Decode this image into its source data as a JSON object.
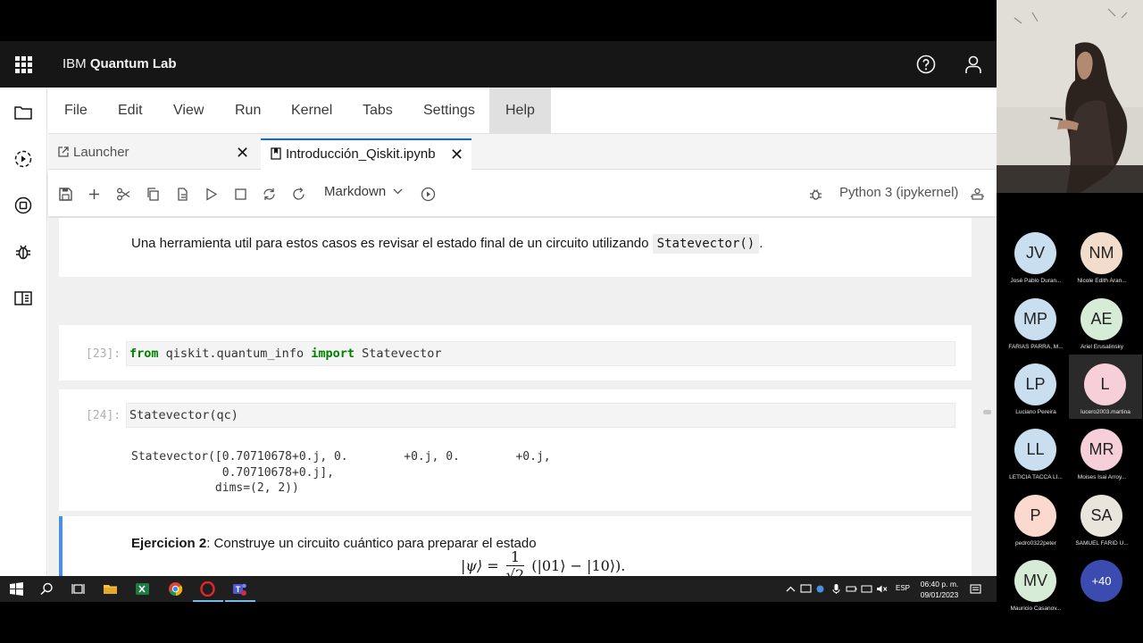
{
  "app": {
    "brand_prefix": "IBM ",
    "brand_name": "Quantum Lab"
  },
  "menu": [
    "File",
    "Edit",
    "View",
    "Run",
    "Kernel",
    "Tabs",
    "Settings",
    "Help"
  ],
  "tabs": {
    "launcher": "Launcher",
    "notebook": "Introducción_Qiskit.ipynb",
    "close": "✕"
  },
  "toolbar": {
    "cell_type": "Markdown",
    "kernel": "Python 3 (ipykernel)"
  },
  "cells": {
    "md1_text": "Una herramienta util para estos casos es revisar el estado final de un circuito utilizando",
    "md1_code": "Statevector()",
    "md1_end": ".",
    "c23_prompt": "[23]:",
    "c23_kw1": "from",
    "c23_mod": " qiskit.quantum_info ",
    "c23_kw2": "import",
    "c23_name": " Statevector",
    "c24_prompt": "[24]:",
    "c24_code": "Statevector(qc)",
    "c24_out1": "Statevector([0.70710678+0.j, 0.        +0.j, 0.        +0.j,",
    "c24_out2": "             0.70710678+0.j],",
    "c24_out3": "            dims=(2, 2))",
    "ex_bold": "Ejercicion 2",
    "ex_text": ": Construye un circuito cuántico para preparar el estado",
    "formula_lhs": "|ψ⟩ =",
    "formula_num": "1",
    "formula_den": "√2",
    "formula_rhs": "(|01⟩ − |10⟩)."
  },
  "taskbar": {
    "lang": "ESP",
    "time": "06:40 p. m.",
    "date": "09/01/2023"
  },
  "participants": [
    {
      "initials": "JV",
      "name": "José Pablo Duran...",
      "color": "#c9dff0"
    },
    {
      "initials": "NM",
      "name": "Nicole Edith Aran...",
      "color": "#f2dccb"
    },
    {
      "initials": "MP",
      "name": "FARIAS PARRA, M...",
      "color": "#c9dff0"
    },
    {
      "initials": "AE",
      "name": "Ariel Erusalinsky",
      "color": "#d6ecd6"
    },
    {
      "initials": "LP",
      "name": "Luciano Pereira",
      "color": "#c9dff0"
    },
    {
      "initials": "L",
      "name": "lucero2003.martina",
      "color": "#f7cfd8"
    },
    {
      "initials": "LL",
      "name": "LETICIA TACCA LI...",
      "color": "#c9dff0"
    },
    {
      "initials": "MR",
      "name": "Moises Isai Arroy...",
      "color": "#f7cfd8"
    },
    {
      "initials": "P",
      "name": "pedro0322peter",
      "color": "#fbd9cf"
    },
    {
      "initials": "SA",
      "name": "SAMUEL FARID U...",
      "color": "#e9e4dc"
    },
    {
      "initials": "MV",
      "name": "Mauricio Casanov...",
      "color": "#d6ecd6"
    }
  ],
  "more_participants": "+40",
  "colors": {
    "topbar": "#161616",
    "accent": "#0f62fe",
    "selection_bar": "#4a90e2",
    "more_bubble": "#3c4bb0"
  }
}
